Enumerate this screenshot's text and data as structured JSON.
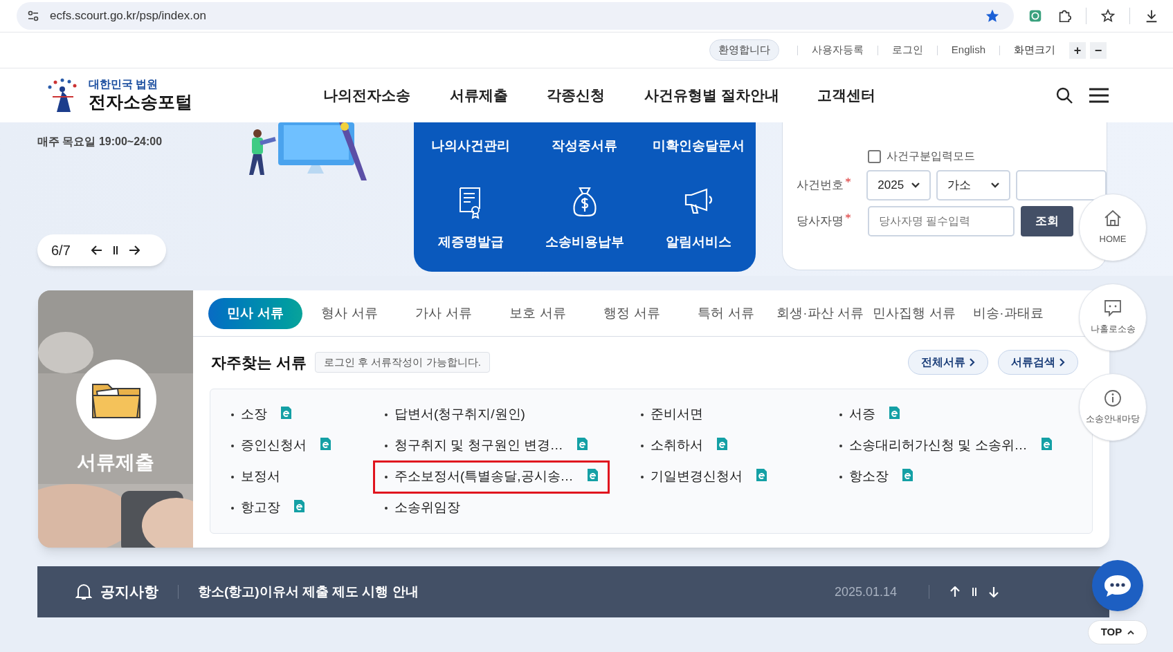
{
  "browser": {
    "url": "ecfs.scourt.go.kr/psp/index.on"
  },
  "utility_bar": {
    "welcome": "환영합니다",
    "links": [
      "사용자등록",
      "로그인",
      "English"
    ],
    "zoom_label": "화면크기",
    "zoom_buttons": [
      "+",
      "−"
    ]
  },
  "header": {
    "logo_top": "대한민국 법원",
    "logo_main": "전자소송포털",
    "nav": [
      "나의전자소송",
      "서류제출",
      "각종신청",
      "사건유형별 절차안내",
      "고객센터"
    ]
  },
  "hero": {
    "notice": "매주 목요일 19:00~24:00",
    "slide_counter": "6/7"
  },
  "quick_panel": {
    "top_links": [
      "나의사건관리",
      "작성중서류",
      "미확인송달문서"
    ],
    "services": [
      "제증명발급",
      "소송비용납부",
      "알림서비스"
    ]
  },
  "case_search": {
    "mode_checkbox": {
      "label": "사건구분입력모드",
      "checked": false
    },
    "case_number": {
      "label": "사건번호",
      "year": "2025",
      "type": "가소"
    },
    "party": {
      "label": "당사자명",
      "placeholder": "당사자명 필수입력"
    },
    "submit": "조회"
  },
  "side_buttons": [
    "HOME",
    "나홀로소송",
    "소송안내마당"
  ],
  "documents": {
    "banner_title": "서류제출",
    "tabs": [
      {
        "label": "민사 서류",
        "selected": true
      },
      {
        "label": "형사 서류",
        "selected": false
      },
      {
        "label": "가사 서류",
        "selected": false
      },
      {
        "label": "보호 서류",
        "selected": false
      },
      {
        "label": "행정 서류",
        "selected": false
      },
      {
        "label": "특허 서류",
        "selected": false
      },
      {
        "label": "회생·파산 서류",
        "selected": false
      },
      {
        "label": "민사집행 서류",
        "selected": false
      },
      {
        "label": "비송·과태료",
        "selected": false
      }
    ],
    "frequent_title": "자주찾는 서류",
    "frequent_hint": "로그인 후 서류작성이 가능합니다.",
    "frequent_buttons": [
      "전체서류",
      "서류검색"
    ],
    "items": [
      {
        "text": "소장",
        "has_form": true,
        "highlighted": false
      },
      {
        "text": "답변서(청구취지/원인)",
        "has_form": false,
        "highlighted": false
      },
      {
        "text": "준비서면",
        "has_form": false,
        "highlighted": false
      },
      {
        "text": "서증",
        "has_form": true,
        "highlighted": false
      },
      {
        "text": "증인신청서",
        "has_form": true,
        "highlighted": false
      },
      {
        "text": "청구취지 및 청구원인 변경…",
        "has_form": true,
        "highlighted": false
      },
      {
        "text": "소취하서",
        "has_form": true,
        "highlighted": false
      },
      {
        "text": "소송대리허가신청 및 소송위…",
        "has_form": true,
        "highlighted": false
      },
      {
        "text": "보정서",
        "has_form": false,
        "highlighted": false
      },
      {
        "text": "주소보정서(특별송달,공시송…",
        "has_form": true,
        "highlighted": true
      },
      {
        "text": "기일변경신청서",
        "has_form": true,
        "highlighted": false
      },
      {
        "text": "항소장",
        "has_form": true,
        "highlighted": false
      },
      {
        "text": "항고장",
        "has_form": true,
        "highlighted": false
      },
      {
        "text": "소송위임장",
        "has_form": false,
        "highlighted": false
      }
    ]
  },
  "notice_bar": {
    "label": "공지사항",
    "title": "항소(항고)이유서 제출 제도 시행 안내",
    "date": "2025.01.14"
  },
  "top_button": "TOP"
}
